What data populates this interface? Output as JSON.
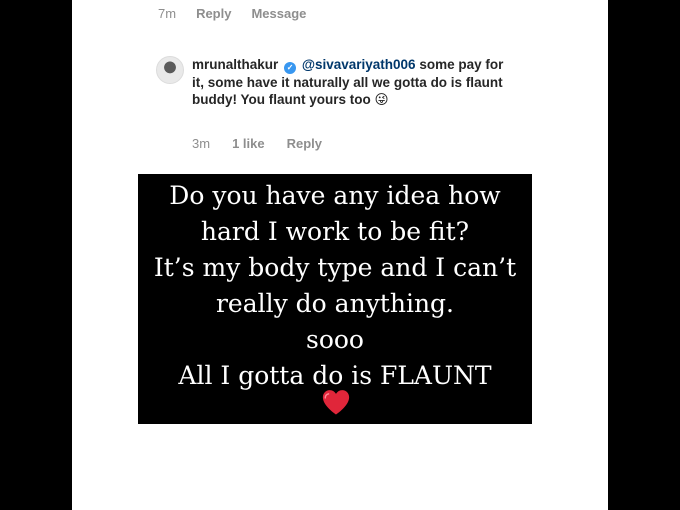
{
  "previous_comment_meta": {
    "time": "7m",
    "reply_label": "Reply",
    "message_label": "Message"
  },
  "comment": {
    "username": "mrunalthakur",
    "verified_icon": "verified-badge-icon",
    "mention": "@sivavariyath006",
    "text_part1": " some pay for it, some have it naturally all we gotta do is flaunt buddy! You flaunt yours too ",
    "emoji": "😜",
    "time": "3m",
    "likes": "1 like",
    "reply_label": "Reply",
    "like_icon": "heart-outline-icon"
  },
  "story": {
    "lines": [
      "Do you have any idea how",
      "hard I work to be fit?",
      "It’s my body type and I can’t",
      "really do anything.",
      "sooo",
      "All I gotta do is FLAUNT"
    ],
    "heart_icon": "red-heart-icon",
    "heart_color": "#e0263a"
  },
  "colors": {
    "background": "#000000",
    "panel": "#ffffff",
    "meta_gray": "#8e8e8e",
    "mention_blue": "#00376b",
    "verified_blue": "#3897f0"
  }
}
